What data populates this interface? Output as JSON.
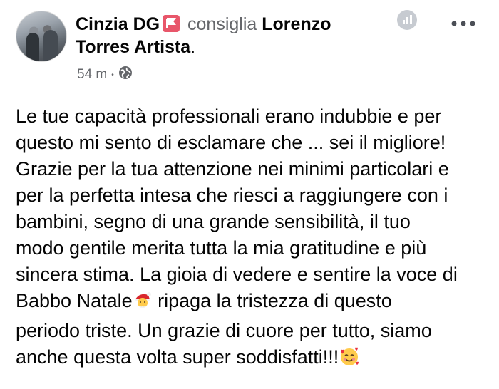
{
  "post": {
    "author": "Cinzia DG",
    "verb": "consiglia",
    "page_name": "Lorenzo Torres Artista",
    "time": "54 m",
    "separator": "•",
    "text": {
      "line1": "Le tue capacità professionali erano indubbie e per",
      "line2": "questo mi sento di esclamare che ... sei il migliore!",
      "line3": "Grazie per la tua attenzione nei minimi particolari  e",
      "line4": "per la perfetta intesa che riesci a raggiungere con i",
      "line5": "bambini, segno di una grande sensibilità, il tuo",
      "line6": "modo gentile merita tutta la mia gratitudine e più",
      "line7": "sincera stima. La gioia di vedere e sentire la voce di",
      "line8a": "Babbo Natale",
      "line8b": " ripaga la tristezza di questo",
      "line9": "periodo triste. Un grazie di cuore per tutto, siamo",
      "line10": "anche questa volta super soddisfatti!!!"
    }
  },
  "icons": {
    "recommend_badge": "recommend-flag-icon",
    "privacy": "globe-icon",
    "insights": "bar-chart-icon",
    "more": "more-options-icon",
    "santa": "santa-emoji-icon",
    "hearts": "smiling-face-with-hearts-emoji-icon"
  },
  "colors": {
    "text": "#050505",
    "secondary": "#65676b",
    "badge": "#e8566a"
  }
}
